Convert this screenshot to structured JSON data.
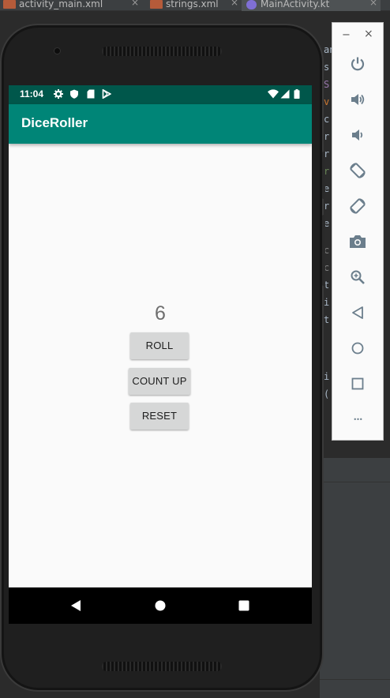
{
  "ide": {
    "tabs": [
      {
        "label": "activity_main.xml",
        "icon": "xml-file-icon"
      },
      {
        "label": "strings.xml",
        "icon": "xml-file-icon"
      },
      {
        "label": "MainActivity.kt",
        "icon": "kotlin-file-icon",
        "active": true
      }
    ],
    "close_glyph": "×",
    "code_lines": [
      "an",
      "s:",
      "S",
      "v",
      "c",
      "r",
      "r",
      "r",
      "e",
      "r",
      "e",
      "c",
      "c",
      "t",
      "i",
      "t",
      "i",
      "("
    ]
  },
  "emulator": {
    "status_bar": {
      "time": "11:04",
      "left_icons": [
        "settings-icon",
        "shield-icon",
        "sd-card-icon",
        "play-store-icon"
      ],
      "right_icons": [
        "wifi-icon",
        "cell-signal-icon",
        "battery-icon"
      ]
    },
    "app": {
      "title": "DiceRoller",
      "result": "6",
      "buttons": {
        "roll": "ROLL",
        "count_up": "COUNT UP",
        "reset": "RESET"
      }
    },
    "nav_bar": [
      "back-icon",
      "home-icon",
      "recents-icon"
    ],
    "colors": {
      "primary": "#008577",
      "primary_dark": "#00574B",
      "background": "#FAFAFA",
      "button": "#D6D7D7"
    },
    "toolbar": {
      "minimize": "−",
      "close": "×",
      "more": "•••",
      "buttons": [
        "power-icon",
        "volume-up-icon",
        "volume-down-icon",
        "rotate-left-icon",
        "rotate-right-icon",
        "camera-icon",
        "zoom-icon",
        "back-icon",
        "home-icon",
        "overview-icon",
        "more-icon"
      ]
    }
  }
}
